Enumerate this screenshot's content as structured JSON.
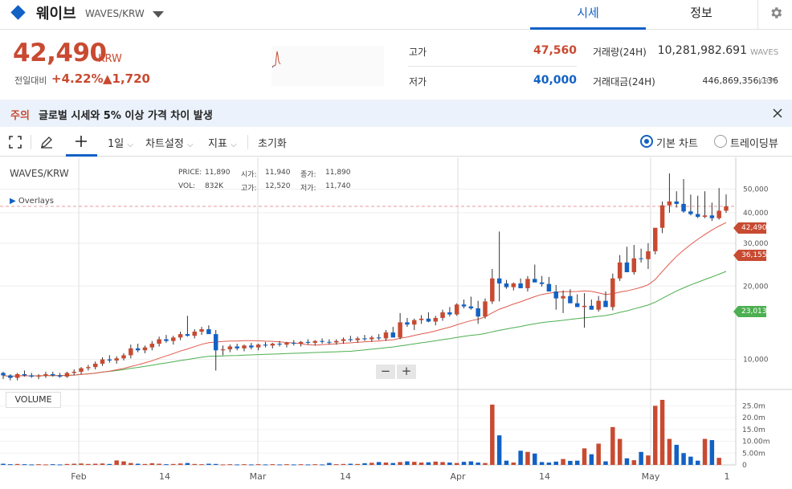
{
  "header": {
    "coin_name": "웨이브",
    "pair": "WAVES/KRW",
    "tabs": [
      "시세",
      "정보"
    ]
  },
  "ticker": {
    "price": "42,490",
    "unit": "KRW",
    "change_label": "전일대비",
    "change_rate": "+4.22%",
    "change_amount": "▲1,720"
  },
  "stats": {
    "high_label": "고가",
    "high_value": "47,560",
    "low_label": "저가",
    "low_value": "40,000",
    "volume_label": "거래량(24H)",
    "volume_value": "10,281,982.691",
    "volume_unit": "WAVES",
    "amount_label": "거래대금(24H)",
    "amount_value": "446,869,356,136",
    "amount_unit": "KRW"
  },
  "notice": {
    "tag": "주의",
    "text": "글로벌 시세와 5% 이상 가격 차이 발생"
  },
  "toolbar": {
    "interval": "1일",
    "chart_settings": "차트설정",
    "indicators": "지표",
    "reset": "초기화",
    "basic_chart": "기본 차트",
    "trading_view": "트레이딩뷰"
  },
  "chart": {
    "symbol": "WAVES/KRW",
    "overlays": "Overlays",
    "info": {
      "price_label": "PRICE:",
      "price": "11,890",
      "open_label": "시가:",
      "open": "11,940",
      "close_label": "종가:",
      "close": "11,890",
      "vol_label": "VOL:",
      "vol": "832K",
      "high_label": "고가:",
      "high": "12,520",
      "low_label": "저가:",
      "low": "11,740"
    },
    "volume_button": "VOLUME",
    "price_ticks": [
      "50,000",
      "40,000",
      "30,000",
      "20,000",
      "10,000"
    ],
    "volume_ticks": [
      "25.0m",
      "20.0m",
      "15.0m",
      "10.00m",
      "5.00m",
      "0"
    ],
    "x_ticks": [
      "Feb",
      "14",
      "Mar",
      "14",
      "Apr",
      "14",
      "May",
      "1"
    ],
    "tag_last": "42,490",
    "tag_ma_short": "36,155",
    "tag_ma_long": "23,013",
    "colors": {
      "up": "#c84a31",
      "down": "#1261c4",
      "ma_short": "#e05a4c",
      "ma_long": "#4caf50"
    }
  },
  "chart_data": {
    "type": "candlestick",
    "series": [
      {
        "name": "WAVES/KRW",
        "ohlc": [
          [
            8800,
            8900,
            8300,
            8600
          ],
          [
            8600,
            8700,
            8200,
            8400
          ],
          [
            8400,
            8800,
            8200,
            8700
          ],
          [
            8700,
            9000,
            8500,
            8600
          ],
          [
            8600,
            8800,
            8400,
            8500
          ],
          [
            8500,
            8700,
            8300,
            8600
          ],
          [
            8600,
            8900,
            8400,
            8700
          ],
          [
            8700,
            8900,
            8500,
            8600
          ],
          [
            8600,
            8800,
            8400,
            8500
          ],
          [
            8500,
            8900,
            8400,
            8800
          ],
          [
            8800,
            9100,
            8600,
            8900
          ],
          [
            8900,
            9300,
            8700,
            9200
          ],
          [
            9200,
            9500,
            9000,
            9300
          ],
          [
            9300,
            9800,
            9100,
            9600
          ],
          [
            9600,
            10200,
            9400,
            10000
          ],
          [
            10000,
            10400,
            9700,
            9900
          ],
          [
            9900,
            10300,
            9600,
            10100
          ],
          [
            10100,
            10600,
            9900,
            10400
          ],
          [
            10400,
            11500,
            10100,
            11100
          ],
          [
            11100,
            11600,
            10700,
            10900
          ],
          [
            10900,
            11400,
            10600,
            11200
          ],
          [
            11200,
            11900,
            10900,
            11600
          ],
          [
            11600,
            12400,
            11300,
            12100
          ],
          [
            12100,
            12600,
            11700,
            11900
          ],
          [
            11900,
            12500,
            11500,
            12300
          ],
          [
            12300,
            13000,
            12000,
            12700
          ],
          [
            12700,
            15100,
            12400,
            12500
          ],
          [
            12500,
            13300,
            12200,
            13000
          ],
          [
            13000,
            13600,
            12600,
            13300
          ],
          [
            13300,
            13800,
            12900,
            12700
          ],
          [
            12700,
            13200,
            9000,
            10900
          ],
          [
            10900,
            11400,
            10400,
            11000
          ],
          [
            11000,
            11500,
            10700,
            11300
          ],
          [
            11300,
            11600,
            10900,
            11100
          ],
          [
            11100,
            11500,
            10800,
            11400
          ],
          [
            11400,
            11700,
            11000,
            11200
          ],
          [
            11200,
            11600,
            10900,
            11500
          ],
          [
            11500,
            11800,
            11200,
            11400
          ],
          [
            11400,
            11700,
            11100,
            11600
          ],
          [
            11600,
            11900,
            11300,
            11500
          ],
          [
            11500,
            11800,
            11200,
            11700
          ],
          [
            11700,
            12000,
            11400,
            11600
          ],
          [
            11600,
            11900,
            11300,
            11800
          ],
          [
            11800,
            12100,
            11500,
            11700
          ],
          [
            11700,
            12000,
            11400,
            11900
          ],
          [
            11900,
            12200,
            11600,
            11800
          ],
          [
            11800,
            12100,
            11500,
            11740
          ],
          [
            11740,
            12100,
            11500,
            11900
          ],
          [
            11900,
            12300,
            11600,
            12100
          ],
          [
            12100,
            12500,
            11800,
            12000
          ],
          [
            12000,
            12400,
            11700,
            12200
          ],
          [
            12200,
            12600,
            11900,
            12100
          ],
          [
            12100,
            12500,
            11800,
            12300
          ],
          [
            12300,
            12700,
            12000,
            12200
          ],
          [
            12200,
            13200,
            11900,
            12900
          ],
          [
            12900,
            13600,
            12600,
            12300
          ],
          [
            12300,
            15500,
            12100,
            14200
          ],
          [
            14200,
            14800,
            13600,
            13900
          ],
          [
            13900,
            14700,
            13200,
            14500
          ],
          [
            14500,
            15200,
            14000,
            14700
          ],
          [
            14700,
            15600,
            14200,
            14300
          ],
          [
            14300,
            15100,
            13800,
            14800
          ],
          [
            14800,
            16000,
            14400,
            15600
          ],
          [
            15600,
            16400,
            15000,
            15300
          ],
          [
            15300,
            17000,
            15100,
            16800
          ],
          [
            16800,
            17600,
            16200,
            16500
          ],
          [
            16500,
            18100,
            16000,
            16200
          ],
          [
            16200,
            17400,
            14000,
            15000
          ],
          [
            15000,
            17800,
            14700,
            17300
          ],
          [
            17300,
            23500,
            16900,
            21500
          ],
          [
            21500,
            33500,
            17300,
            20500
          ],
          [
            20500,
            21200,
            19500,
            19800
          ],
          [
            19800,
            20700,
            19200,
            20500
          ],
          [
            20500,
            21500,
            19800,
            19600
          ],
          [
            19600,
            22000,
            19000,
            21400
          ],
          [
            21400,
            24500,
            21000,
            20700
          ],
          [
            20700,
            22000,
            19900,
            20400
          ],
          [
            20400,
            21800,
            19500,
            19000
          ],
          [
            19000,
            20200,
            16000,
            17800
          ],
          [
            17800,
            19200,
            15500,
            18200
          ],
          [
            18200,
            19400,
            17600,
            17000
          ],
          [
            17000,
            18500,
            16500,
            16400
          ],
          [
            16400,
            18700,
            13500,
            16600
          ],
          [
            16600,
            17600,
            16000,
            16000
          ],
          [
            16000,
            18200,
            15700,
            17400
          ],
          [
            17400,
            19000,
            16800,
            16400
          ],
          [
            16400,
            22500,
            15900,
            21500
          ],
          [
            21500,
            26800,
            21000,
            25000
          ],
          [
            25000,
            29000,
            24000,
            22800
          ],
          [
            22800,
            29500,
            22300,
            26000
          ],
          [
            26000,
            28500,
            25000,
            25800
          ],
          [
            25800,
            30000,
            23500,
            27800
          ],
          [
            27800,
            33500,
            27000,
            34700
          ],
          [
            34700,
            44500,
            33000,
            42900
          ],
          [
            42900,
            58000,
            40000,
            44500
          ],
          [
            44500,
            49000,
            42000,
            43500
          ],
          [
            43500,
            55000,
            40000,
            40500
          ],
          [
            40500,
            47500,
            39000,
            39500
          ],
          [
            39500,
            47000,
            38000,
            38500
          ],
          [
            38500,
            49000,
            38000,
            39000
          ],
          [
            39000,
            44000,
            37000,
            38000
          ],
          [
            38000,
            50500,
            37500,
            40770
          ],
          [
            40770,
            47560,
            40000,
            42490
          ]
        ]
      },
      {
        "name": "VOLUME",
        "values": [
          0.5,
          0.3,
          0.4,
          0.3,
          0.2,
          0.3,
          0.2,
          0.3,
          0.2,
          0.4,
          0.5,
          0.6,
          0.4,
          0.5,
          0.6,
          0.4,
          1.9,
          1.5,
          0.8,
          0.5,
          0.4,
          0.7,
          0.5,
          0.3,
          0.4,
          0.6,
          0.8,
          0.4,
          0.3,
          0.5,
          0.4,
          0.2,
          0.3,
          0.2,
          0.3,
          0.2,
          0.3,
          0.2,
          0.3,
          0.2,
          0.3,
          0.2,
          0.3,
          0.2,
          0.3,
          0.2,
          0.832,
          0.3,
          0.4,
          0.5,
          0.4,
          0.7,
          0.9,
          1.2,
          1.0,
          0.8,
          1.2,
          1.5,
          1.3,
          1.0,
          1.1,
          1.4,
          1.2,
          1.0,
          0.8,
          1.3,
          1.5,
          1.0,
          0.8,
          25.5,
          12.5,
          1.8,
          1.0,
          6.0,
          5.5,
          4.8,
          1.2,
          1.0,
          1.4,
          2.5,
          1.7,
          1.8,
          7.0,
          4.5,
          9.0,
          1.5,
          16.0,
          11.0,
          2.8,
          2.0,
          5.5,
          4.0,
          25.0,
          27.5,
          11.0,
          8.5,
          5.0,
          3.5,
          1.8,
          11.0,
          10.5,
          3.0
        ]
      }
    ],
    "ma_short_last": 36155,
    "ma_long_last": 23013,
    "ylim_price_log": [
      8000,
      58000
    ],
    "ylim_volume": [
      0,
      27.5
    ],
    "x_ticks": [
      "Feb",
      "14",
      "Mar",
      "14",
      "Apr",
      "14",
      "May",
      "1"
    ]
  }
}
